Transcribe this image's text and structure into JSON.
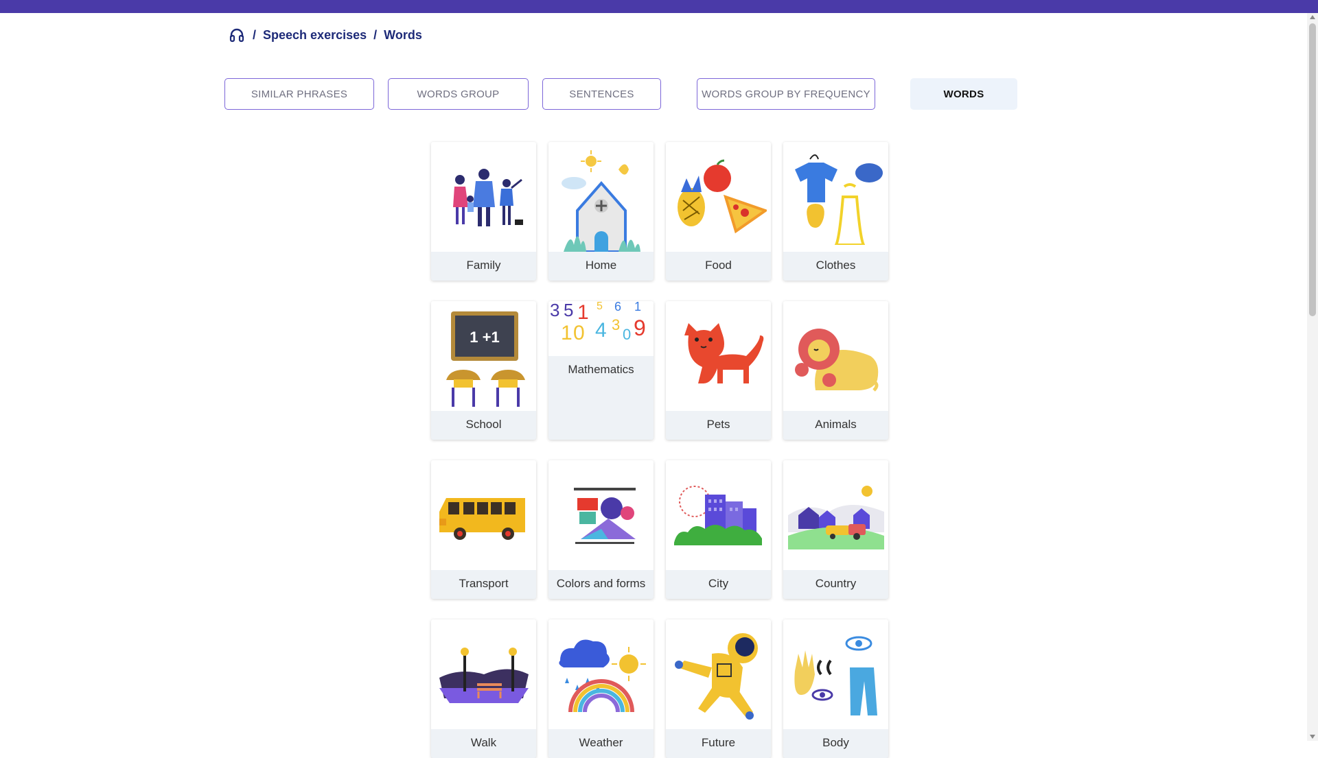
{
  "breadcrumb": {
    "home_icon": "headphones-icon",
    "items": [
      "Speech exercises",
      "Words"
    ],
    "separator": "/"
  },
  "tabs": [
    {
      "label": "SIMILAR PHRASES",
      "active": false
    },
    {
      "label": "WORDS GROUP",
      "active": false
    },
    {
      "label": "SENTENCES",
      "active": false
    },
    {
      "label": "WORDS GROUP BY FREQUENCY",
      "active": false
    },
    {
      "label": "WORDS",
      "active": true
    }
  ],
  "categories": [
    {
      "label": "Family",
      "icon": "family-icon"
    },
    {
      "label": "Home",
      "icon": "house-icon"
    },
    {
      "label": "Food",
      "icon": "food-icon"
    },
    {
      "label": "Clothes",
      "icon": "clothes-icon"
    },
    {
      "label": "School",
      "icon": "school-icon"
    },
    {
      "label": "Mathematics",
      "icon": "numbers-icon"
    },
    {
      "label": "Pets",
      "icon": "cat-icon"
    },
    {
      "label": "Animals",
      "icon": "lion-icon"
    },
    {
      "label": "Transport",
      "icon": "bus-icon"
    },
    {
      "label": "Colors and forms",
      "icon": "shapes-icon"
    },
    {
      "label": "City",
      "icon": "city-icon"
    },
    {
      "label": "Country",
      "icon": "countryside-icon"
    },
    {
      "label": "Walk",
      "icon": "park-icon"
    },
    {
      "label": "Weather",
      "icon": "weather-icon"
    },
    {
      "label": "Future",
      "icon": "astronaut-icon"
    },
    {
      "label": "Body",
      "icon": "body-icon"
    }
  ],
  "colors": {
    "topbar": "#4a3aa8",
    "breadcrumb": "#1d2a78",
    "tab_border": "#7b65d8",
    "active_tab_bg": "#edf3fb",
    "card_label_bg": "#eef2f6"
  }
}
